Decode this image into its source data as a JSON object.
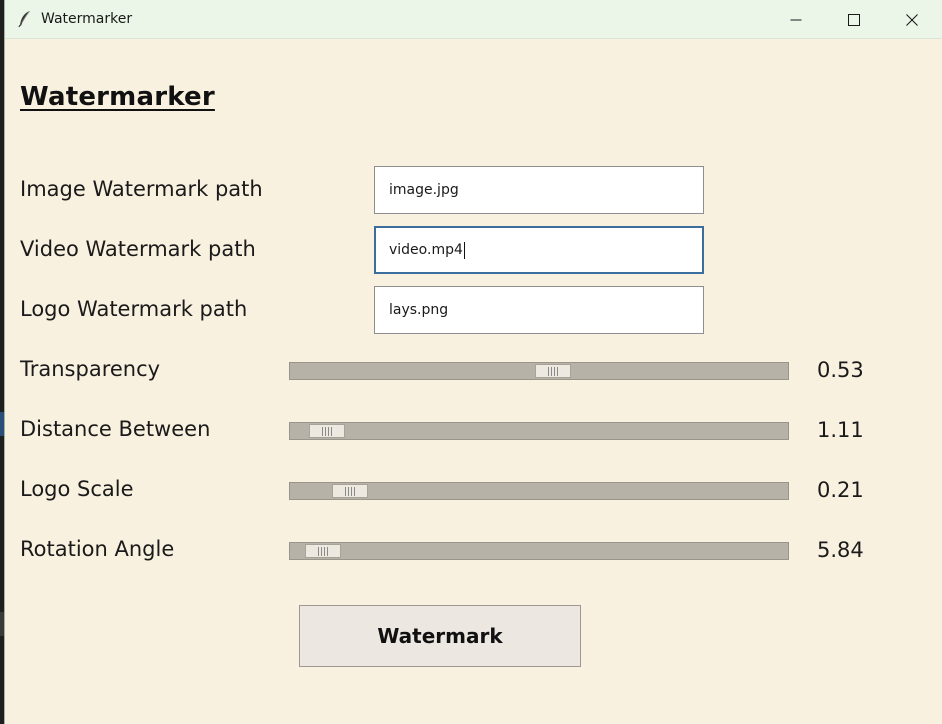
{
  "window": {
    "title": "Watermarker",
    "icon": "feather-icon"
  },
  "heading": "Watermarker",
  "fields": {
    "image_label": "Image Watermark path",
    "image_value": "image.jpg",
    "video_label": "Video Watermark path",
    "video_value": "video.mp4",
    "logo_label": "Logo Watermark path",
    "logo_value": "lays.png"
  },
  "sliders": {
    "transparency_label": "Transparency",
    "transparency_value": "0.53",
    "distance_label": "Distance Between",
    "distance_value": "1.11",
    "scale_label": "Logo Scale",
    "scale_value": "0.21",
    "rotation_label": "Rotation Angle",
    "rotation_value": "5.84"
  },
  "slider_levels": {
    "transparency": 0.53,
    "distance": 0.04,
    "scale": 0.09,
    "rotation": 0.03
  },
  "action": {
    "label": "Watermark"
  },
  "colors": {
    "background": "#f9f1e0",
    "titlebar": "#ebf6e8",
    "focus_border": "#3b6e9d",
    "trough": "#b7b2a8"
  }
}
